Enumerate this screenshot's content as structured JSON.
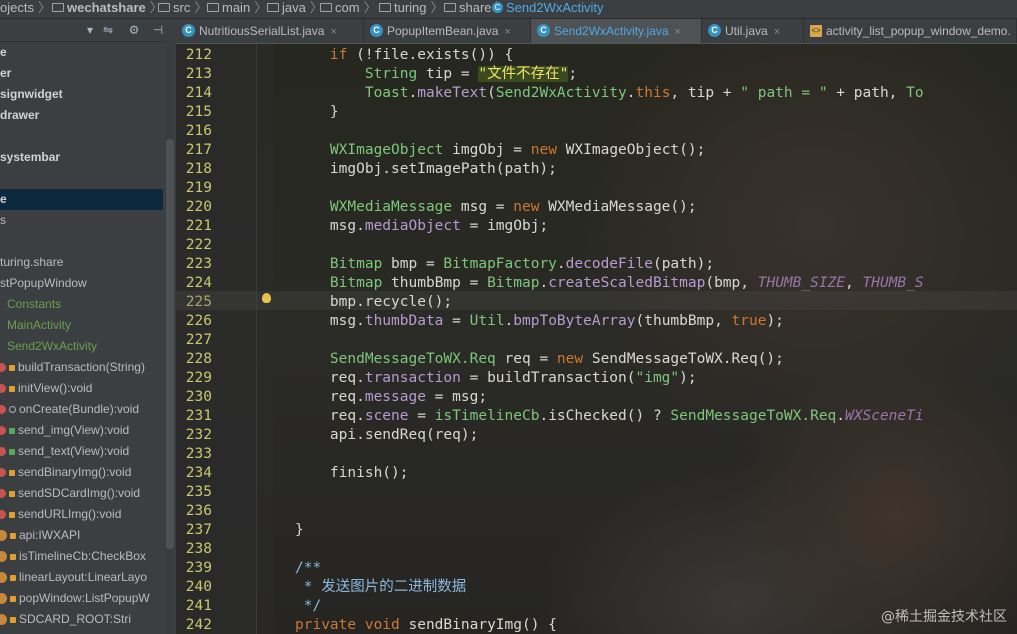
{
  "breadcrumbs": [
    "ojects",
    "wechatshare",
    "src",
    "main",
    "java",
    "com",
    "turing",
    "share",
    "Send2WxActivity"
  ],
  "tabs": [
    {
      "label": "NutritiousSerialList.java",
      "icon": "class-icon"
    },
    {
      "label": "PopupItemBean.java",
      "icon": "class-icon"
    },
    {
      "label": "Send2WxActivity.java",
      "icon": "class-icon",
      "active": true
    },
    {
      "label": "Util.java",
      "icon": "class-icon"
    },
    {
      "label": "activity_list_popup_window_demo.",
      "icon": "xml-layout-icon"
    }
  ],
  "tab_close": "×",
  "toolbar": {
    "dropdown": "▾",
    "settings": "⚙",
    "collapse": "⇋",
    "hide": "⊣"
  },
  "structure": [
    {
      "label": "e",
      "style": "bold"
    },
    {
      "label": "er",
      "style": "bold"
    },
    {
      "label": "signwidget",
      "style": "bold"
    },
    {
      "label": "drawer",
      "style": "bold"
    },
    {
      "label": "",
      "style": "bold"
    },
    {
      "label": "systembar",
      "style": "bold"
    },
    {
      "label": "",
      "style": "bold"
    },
    {
      "label": "e",
      "style": "bold",
      "selected": true
    },
    {
      "label": "s",
      "style": "plain"
    },
    {
      "label": "",
      "style": "plain"
    },
    {
      "label": "turing.share",
      "style": "plain"
    },
    {
      "label": "stPopupWindow",
      "style": "plain"
    },
    {
      "label": "Constants",
      "style": "green"
    },
    {
      "label": "MainActivity",
      "style": "green"
    },
    {
      "label": "Send2WxActivity",
      "style": "green"
    },
    {
      "label": "buildTransaction(String)",
      "style": "member",
      "access": "private"
    },
    {
      "label": "initView():void",
      "style": "member",
      "access": "private"
    },
    {
      "label": "onCreate(Bundle):void",
      "style": "member",
      "access": "protected"
    },
    {
      "label": "send_img(View):void",
      "style": "member",
      "access": "public"
    },
    {
      "label": "send_text(View):void",
      "style": "member",
      "access": "public"
    },
    {
      "label": "sendBinaryImg():void",
      "style": "member",
      "access": "private"
    },
    {
      "label": "sendSDCardImg():void",
      "style": "member",
      "access": "private"
    },
    {
      "label": "sendURLImg():void",
      "style": "member",
      "access": "private"
    },
    {
      "label": "api:IWXAPI",
      "style": "field",
      "access": "private"
    },
    {
      "label": "isTimelineCb:CheckBox",
      "style": "field",
      "access": "private"
    },
    {
      "label": "linearLayout:LinearLayo",
      "style": "field",
      "access": "private"
    },
    {
      "label": "popWindow:ListPopupW",
      "style": "field",
      "access": "private"
    },
    {
      "label": "SDCARD_ROOT:Stri",
      "style": "field",
      "access": "private"
    }
  ],
  "editor": {
    "current_line": 225,
    "line_numbers": [
      212,
      213,
      214,
      215,
      216,
      217,
      218,
      219,
      220,
      221,
      222,
      223,
      224,
      225,
      226,
      227,
      228,
      229,
      230,
      231,
      232,
      233,
      234,
      235,
      236,
      237,
      238,
      239,
      240,
      241,
      242
    ],
    "code": [
      [
        {
          "t": "    "
        },
        {
          "t": "if",
          "c": "kw"
        },
        {
          "t": " (!file.exists()) {"
        }
      ],
      [
        {
          "t": "        "
        },
        {
          "t": "String",
          "c": "ty"
        },
        {
          "t": " tip = "
        },
        {
          "t": "\"文件不存在\"",
          "c": "hl"
        },
        {
          "t": ";"
        }
      ],
      [
        {
          "t": "        "
        },
        {
          "t": "Toast",
          "c": "ty"
        },
        {
          "t": "."
        },
        {
          "t": "makeText",
          "c": "fd"
        },
        {
          "t": "("
        },
        {
          "t": "Send2WxActivity",
          "c": "ty"
        },
        {
          "t": "."
        },
        {
          "t": "this",
          "c": "kw"
        },
        {
          "t": ", tip + "
        },
        {
          "t": "\" path = \"",
          "c": "st"
        },
        {
          "t": " + path, "
        },
        {
          "t": "To",
          "c": "ty"
        }
      ],
      [
        {
          "t": "    }"
        }
      ],
      [],
      [
        {
          "t": "    "
        },
        {
          "t": "WXImageObject",
          "c": "ty"
        },
        {
          "t": " imgObj = "
        },
        {
          "t": "new",
          "c": "kw"
        },
        {
          "t": " WXImageObject();"
        }
      ],
      [
        {
          "t": "    imgObj.setImagePath(path);"
        }
      ],
      [],
      [
        {
          "t": "    "
        },
        {
          "t": "WXMediaMessage",
          "c": "ty"
        },
        {
          "t": " msg = "
        },
        {
          "t": "new",
          "c": "kw"
        },
        {
          "t": " WXMediaMessage();"
        }
      ],
      [
        {
          "t": "    msg."
        },
        {
          "t": "mediaObject",
          "c": "fd"
        },
        {
          "t": " = imgObj;"
        }
      ],
      [],
      [
        {
          "t": "    "
        },
        {
          "t": "Bitmap",
          "c": "ty"
        },
        {
          "t": " bmp = "
        },
        {
          "t": "BitmapFactory",
          "c": "ty"
        },
        {
          "t": "."
        },
        {
          "t": "decodeFile",
          "c": "fd"
        },
        {
          "t": "(path);"
        }
      ],
      [
        {
          "t": "    "
        },
        {
          "t": "Bitmap",
          "c": "ty"
        },
        {
          "t": " thumbBmp = "
        },
        {
          "t": "Bitmap",
          "c": "ty"
        },
        {
          "t": "."
        },
        {
          "t": "createScaledBitmap",
          "c": "fd"
        },
        {
          "t": "(bmp, "
        },
        {
          "t": "THUMB_SIZE",
          "c": "cn"
        },
        {
          "t": ", "
        },
        {
          "t": "THUMB_S",
          "c": "cn"
        }
      ],
      [
        {
          "t": "    bmp.recycle();"
        }
      ],
      [
        {
          "t": "    msg."
        },
        {
          "t": "thumbData",
          "c": "fd"
        },
        {
          "t": " = "
        },
        {
          "t": "Util",
          "c": "ty"
        },
        {
          "t": "."
        },
        {
          "t": "bmpToByteArray",
          "c": "fd"
        },
        {
          "t": "(thumbBmp, "
        },
        {
          "t": "true",
          "c": "kw"
        },
        {
          "t": ");"
        }
      ],
      [],
      [
        {
          "t": "    "
        },
        {
          "t": "SendMessageToWX.Req",
          "c": "ty"
        },
        {
          "t": " req = "
        },
        {
          "t": "new",
          "c": "kw"
        },
        {
          "t": " SendMessageToWX.Req();"
        }
      ],
      [
        {
          "t": "    req."
        },
        {
          "t": "transaction",
          "c": "fd"
        },
        {
          "t": " = buildTransaction("
        },
        {
          "t": "\"img\"",
          "c": "st"
        },
        {
          "t": ");"
        }
      ],
      [
        {
          "t": "    req."
        },
        {
          "t": "message",
          "c": "fd"
        },
        {
          "t": " = msg;"
        }
      ],
      [
        {
          "t": "    req."
        },
        {
          "t": "scene",
          "c": "fd"
        },
        {
          "t": " = "
        },
        {
          "t": "isTimelineCb",
          "c": "ty"
        },
        {
          "t": ".isChecked() ? "
        },
        {
          "t": "SendMessageToWX.Req",
          "c": "ty"
        },
        {
          "t": "."
        },
        {
          "t": "WXSceneTi",
          "c": "cn"
        }
      ],
      [
        {
          "t": "    api.sendReq(req);"
        }
      ],
      [],
      [
        {
          "t": "    finish();"
        }
      ],
      [],
      [],
      [
        {
          "t": "}"
        }
      ],
      [],
      [
        {
          "t": "/**",
          "c": "co"
        }
      ],
      [
        {
          "t": " * 发送图片的二进制数据",
          "c": "co"
        }
      ],
      [
        {
          "t": " */",
          "c": "co"
        }
      ],
      [
        {
          "t": "private",
          "c": "kw"
        },
        {
          "t": " "
        },
        {
          "t": "void",
          "c": "kw"
        },
        {
          "t": " sendBinaryImg() {"
        }
      ]
    ]
  },
  "watermark": "@稀土掘金技术社区",
  "colors": {
    "selection": "#0d293e",
    "accent": "#4fa9e6",
    "line_number": "#c8c86e"
  }
}
